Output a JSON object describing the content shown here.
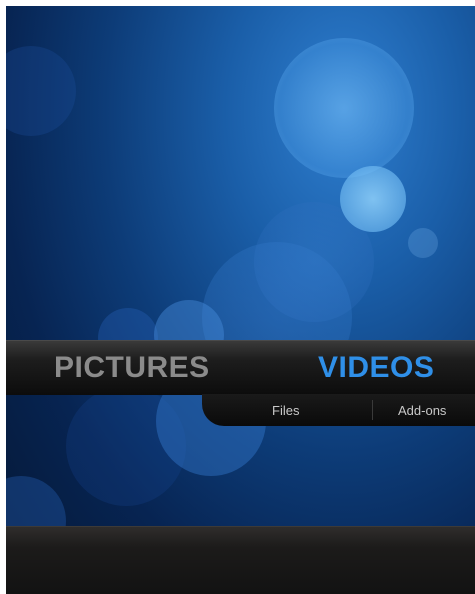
{
  "home_menu": {
    "items": [
      {
        "label": "PICTURES",
        "state": "inactive"
      },
      {
        "label": "VIDEOS",
        "state": "active"
      }
    ],
    "submenu": [
      {
        "label": "Files"
      },
      {
        "label": "Add-ons"
      }
    ]
  },
  "colors": {
    "active_item": "#2f8fe8",
    "inactive_item": "#8b8b8b",
    "background": "#0d3c78"
  }
}
